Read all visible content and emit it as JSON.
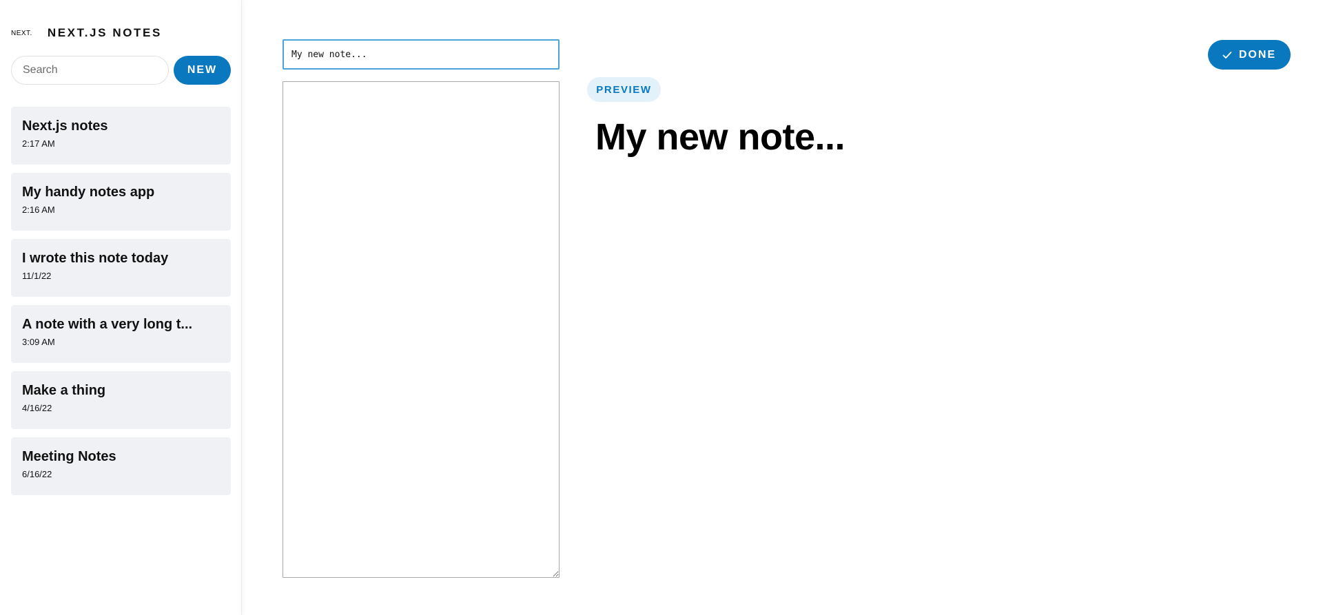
{
  "sidebar": {
    "logo_text": "NEXT.",
    "app_title": "NEXT.JS NOTES",
    "search_placeholder": "Search",
    "new_button_label": "NEW",
    "notes": [
      {
        "title": "Next.js notes",
        "time": "2:17 AM"
      },
      {
        "title": "My handy notes app",
        "time": "2:16 AM"
      },
      {
        "title": "I wrote this note today",
        "time": "11/1/22"
      },
      {
        "title": "A note with a very long t...",
        "time": "3:09 AM"
      },
      {
        "title": "Make a thing",
        "time": "4/16/22"
      },
      {
        "title": "Meeting Notes",
        "time": "6/16/22"
      }
    ]
  },
  "editor": {
    "title_value": "My new note...",
    "body_value": "",
    "preview_label": "PREVIEW",
    "preview_title": "My new note...",
    "done_label": "DONE"
  },
  "colors": {
    "accent": "#0a78bf",
    "note_card_bg": "#f0f1f4",
    "preview_badge_bg": "#e3f1fb"
  },
  "icons": {
    "done": "check-icon"
  }
}
